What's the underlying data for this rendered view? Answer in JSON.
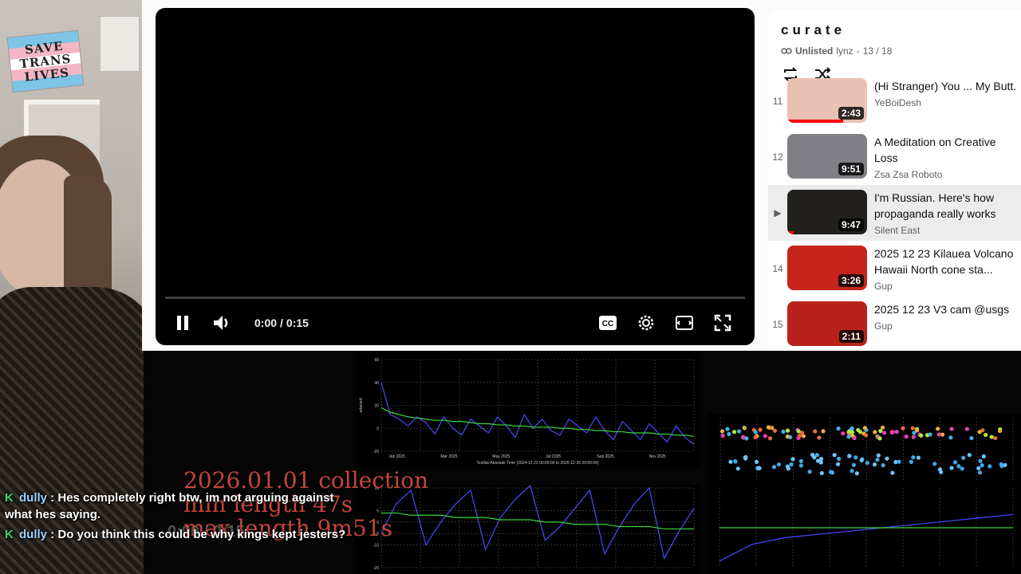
{
  "webcam": {
    "sign_lines": [
      "SAVE",
      "TRANS",
      "LIVES"
    ]
  },
  "player": {
    "current_time": "0:00",
    "duration": "0:15",
    "progress": 0.0,
    "icons": [
      "pause-icon",
      "volume-icon",
      "captions-icon",
      "settings-icon",
      "theater-mode-icon",
      "fullscreen-icon"
    ]
  },
  "playlist": {
    "title": "curate",
    "visibility": "Unlisted",
    "owner": "lynz",
    "position": "13 / 18",
    "items": [
      {
        "index": "11",
        "title": "(Hi Stranger) You ... My Butt.",
        "channel": "YeBoiDesh",
        "duration": "2:43",
        "thumb_color": "#e9c2b4",
        "progress": 0.7
      },
      {
        "index": "12",
        "title": "A Meditation on Creative Loss",
        "channel": "Zsa Zsa Roboto",
        "duration": "9:51",
        "thumb_color": "#7f7f85",
        "progress": 0
      },
      {
        "index": "▶",
        "title": "I'm Russian. Here's how propaganda really works",
        "channel": "Silent East",
        "duration": "9:47",
        "thumb_color": "#22201c",
        "progress": 0.08
      },
      {
        "index": "14",
        "title": "2025 12 23 Kilauea Volcano Hawaii North cone sta...",
        "channel": "Gup",
        "duration": "3:26",
        "thumb_color": "#c7241c",
        "progress": 0
      },
      {
        "index": "15",
        "title": "2025 12 23 V3 cam @usgs",
        "channel": "Gup",
        "duration": "2:11",
        "thumb_color": "#b8221b",
        "progress": 0
      }
    ]
  },
  "overlay": {
    "lines": [
      "2026.01.01 collection",
      "min length 47s",
      "max length 9m51s"
    ],
    "ghost_time": "0:00 / 0:15"
  },
  "chat": [
    {
      "user": "dully",
      "text": "Hes completely right btw, im not arguing against what hes saying."
    },
    {
      "user": "dully",
      "text": "Do you think this could be why kings kept jesters?"
    }
  ],
  "chart_data": [
    {
      "type": "line",
      "ylabel": "retained",
      "x_ticks": [
        "Jan 2025",
        "Mar 2025",
        "May 2025",
        "Jul 2025",
        "Sep 2025",
        "Nov 2025"
      ],
      "xlabel": "Testlist-Absolute Time (2024-12-22 00:00:00 to 2026-12-30 20:00:00)",
      "ylim": [
        -20,
        60
      ],
      "y_ticks": [
        60,
        40,
        20,
        0,
        -20
      ],
      "series": [
        {
          "color": "#4a4aff",
          "values": [
            40,
            12,
            8,
            2,
            10,
            5,
            -5,
            10,
            0,
            -6,
            8,
            2,
            -4,
            10,
            2,
            -8,
            12,
            0,
            8,
            -2,
            -6,
            8,
            2,
            -4,
            10,
            -2,
            -10,
            6,
            -2,
            -10,
            4,
            -4,
            -12,
            2,
            -8,
            -14
          ]
        },
        {
          "color": "#3bd63b",
          "values": [
            18,
            14,
            12,
            10,
            9,
            8,
            7,
            7,
            6,
            6,
            5,
            4,
            4,
            3,
            3,
            2,
            2,
            1,
            1,
            1,
            0,
            0,
            -1,
            -1,
            -2,
            -2,
            -3,
            -3,
            -4,
            -4,
            -4,
            -5,
            -5,
            -6,
            -6,
            -7
          ]
        }
      ]
    },
    {
      "type": "line",
      "ylim": [
        -20,
        15
      ],
      "y_ticks": [
        15,
        5,
        0,
        -5,
        -10,
        -20
      ],
      "series": [
        {
          "color": "#4a4aff",
          "values": [
            -5,
            8,
            14,
            -10,
            0,
            8,
            14,
            -12,
            2,
            10,
            16,
            -8,
            -2,
            6,
            14,
            -14,
            -2,
            8,
            15,
            -16,
            -4,
            6
          ]
        },
        {
          "color": "#3bd63b",
          "values": [
            4,
            4,
            3,
            3,
            3,
            2,
            2,
            2,
            1,
            1,
            1,
            0,
            0,
            -1,
            -1,
            -1,
            -2,
            -2,
            -2,
            -3,
            -3,
            -3
          ]
        }
      ]
    },
    {
      "type": "scatter",
      "series": [
        {
          "name": "top",
          "colors": [
            "#e8b040",
            "#e86b40",
            "#40b0e8",
            "#b0e840",
            "#e840b0"
          ]
        },
        {
          "name": "bottom",
          "colors": [
            "#40a8e8",
            "#6ec3ff"
          ]
        }
      ]
    },
    {
      "type": "line",
      "series": [
        {
          "color": "#4a4aff",
          "values": [
            -10,
            -5,
            -3,
            -2,
            -1,
            0,
            1,
            2,
            3,
            4
          ]
        },
        {
          "color": "#3bd63b",
          "values": [
            0,
            0,
            0,
            0,
            0,
            0,
            0,
            0,
            0,
            0
          ]
        }
      ]
    }
  ]
}
